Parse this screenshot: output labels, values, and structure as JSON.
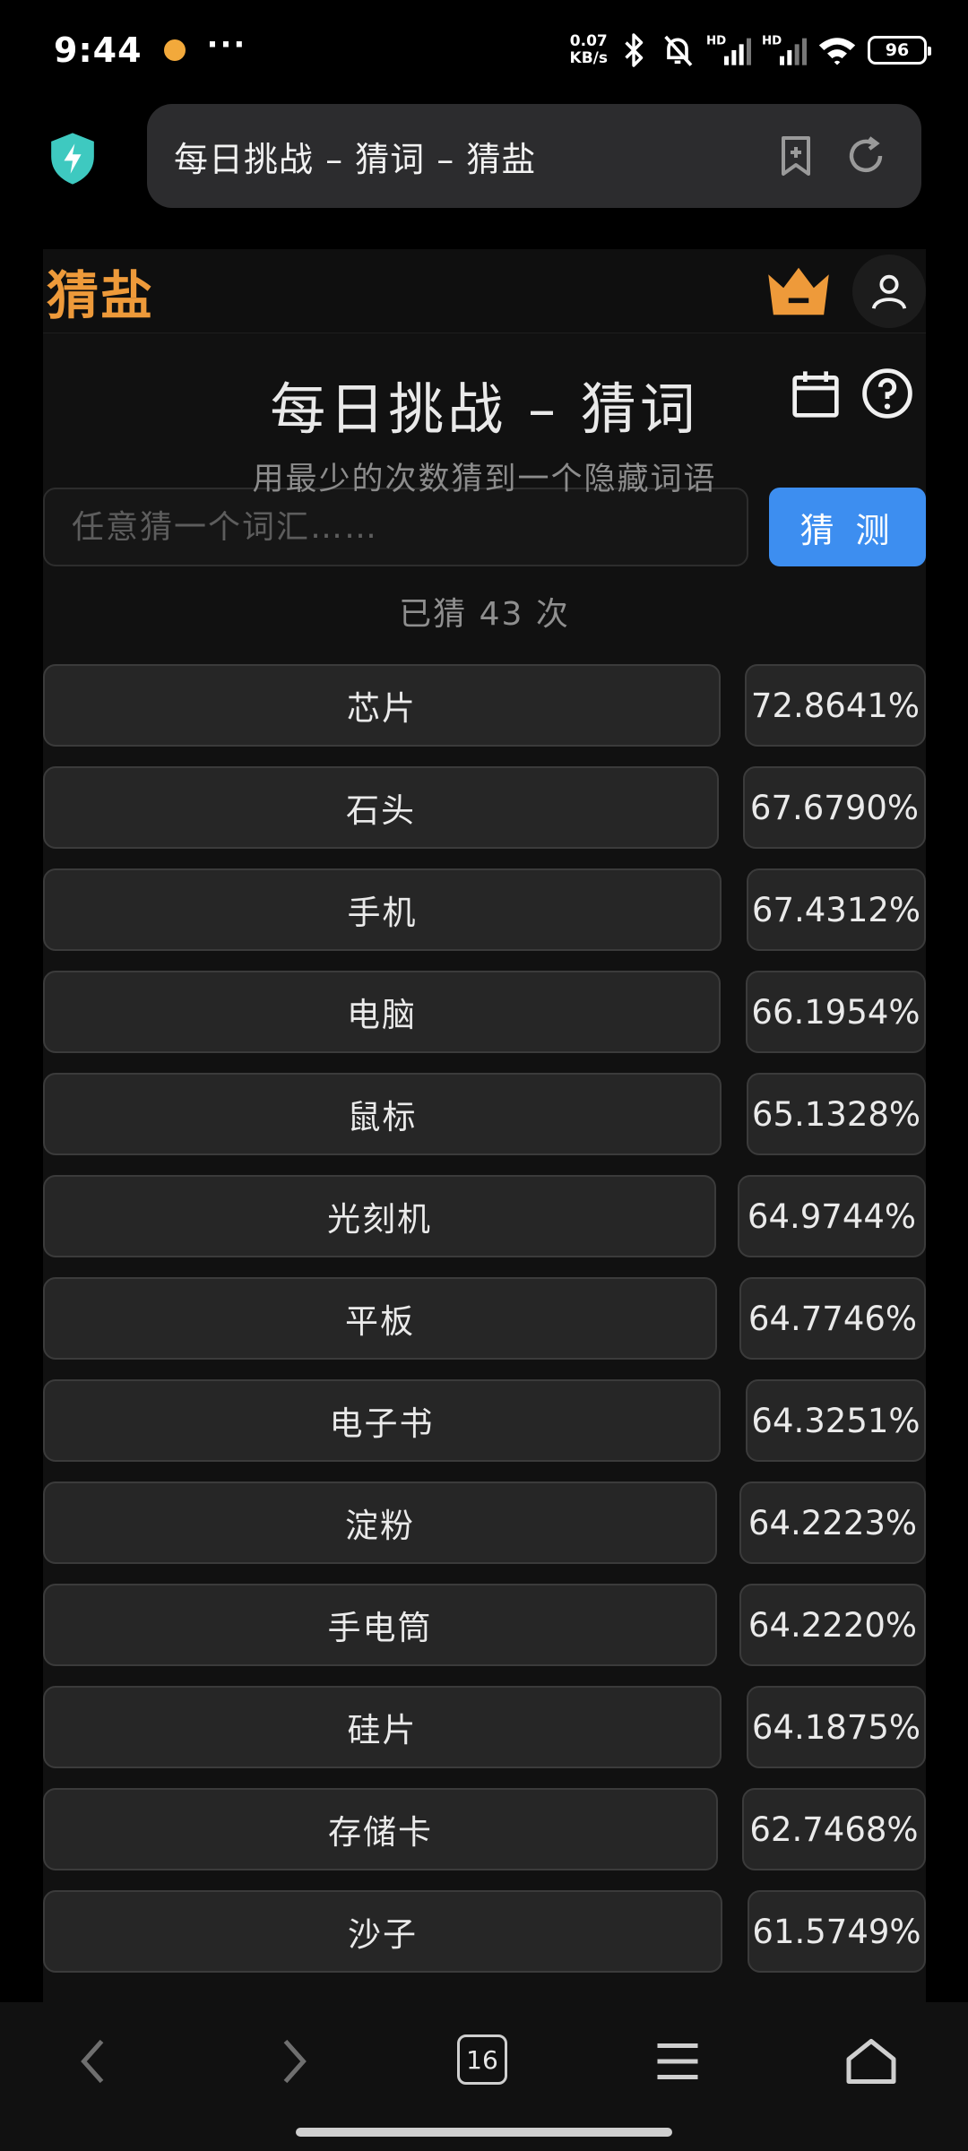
{
  "status": {
    "time": "9:44",
    "speed_top": "0.07",
    "speed_bottom": "KB/s",
    "battery": "96"
  },
  "browser": {
    "url_title": "每日挑战 – 猜词 – 猜盐",
    "tab_count": "16"
  },
  "header": {
    "logo": "猜盐"
  },
  "challenge": {
    "title": "每日挑战 – 猜词",
    "subtitle": "用最少的次数猜到一个隐藏词语"
  },
  "guess": {
    "placeholder": "任意猜一个词汇……",
    "button": "猜 测"
  },
  "count_text": "已猜 43 次",
  "results": [
    {
      "word": "芯片",
      "pct": "72.8641%"
    },
    {
      "word": "石头",
      "pct": "67.6790%"
    },
    {
      "word": "手机",
      "pct": "67.4312%"
    },
    {
      "word": "电脑",
      "pct": "66.1954%"
    },
    {
      "word": "鼠标",
      "pct": "65.1328%"
    },
    {
      "word": "光刻机",
      "pct": "64.9744%"
    },
    {
      "word": "平板",
      "pct": "64.7746%"
    },
    {
      "word": "电子书",
      "pct": "64.3251%"
    },
    {
      "word": "淀粉",
      "pct": "64.2223%"
    },
    {
      "word": "手电筒",
      "pct": "64.2220%"
    },
    {
      "word": "硅片",
      "pct": "64.1875%"
    },
    {
      "word": "存储卡",
      "pct": "62.7468%"
    },
    {
      "word": "沙子",
      "pct": "61.5749%"
    }
  ],
  "colors": {
    "accent_logo": "#ee9a3a",
    "button_blue": "#3d8ef0",
    "shield_teal": "#3ec9c0"
  },
  "icons": {
    "site_security": "shield-bolt-icon",
    "bookmark": "bookmark-plus-icon",
    "reload": "reload-icon",
    "vip": "crown-icon",
    "user": "user-icon",
    "calendar": "calendar-icon",
    "help": "help-circle-icon"
  }
}
